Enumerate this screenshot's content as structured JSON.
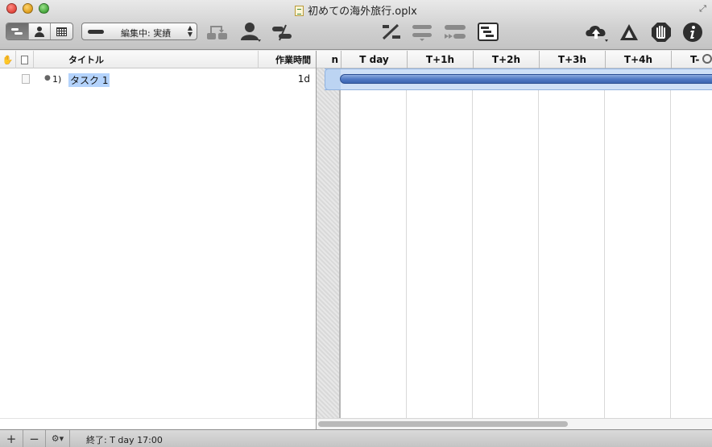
{
  "window": {
    "title": "初めての海外旅行.oplx"
  },
  "toolbar": {
    "view_segments": [
      {
        "name": "gantt-view",
        "active": true
      },
      {
        "name": "resource-view",
        "active": false
      },
      {
        "name": "calendar-view",
        "active": false
      }
    ],
    "style_popup_label": "編集中: 実績",
    "icons": [
      "add-dependency-icon",
      "assign-resource-icon",
      "split-task-icon",
      "percent-complete-icon",
      "level-icon",
      "catch-up-icon",
      "inspector-panel-icon",
      "publish-cloud-icon",
      "violations-icon",
      "stop-icon",
      "info-icon"
    ]
  },
  "outline": {
    "columns": {
      "title_label": "タイトル",
      "effort_label": "作業時間"
    },
    "rows": [
      {
        "number": "1)",
        "title": "タスク 1",
        "effort": "1d",
        "selected": true
      }
    ]
  },
  "gantt": {
    "clipped_left_label": "n",
    "columns": [
      "T day",
      "T+1h",
      "T+2h",
      "T+3h",
      "T+4h",
      "T-"
    ]
  },
  "statusbar": {
    "add_label": "+",
    "remove_label": "−",
    "gear_label": "⚙▾",
    "end_text": "終了: T day 17:00"
  },
  "colors": {
    "task_bar": "#4f78c4",
    "selection": "#b4d3fc"
  }
}
